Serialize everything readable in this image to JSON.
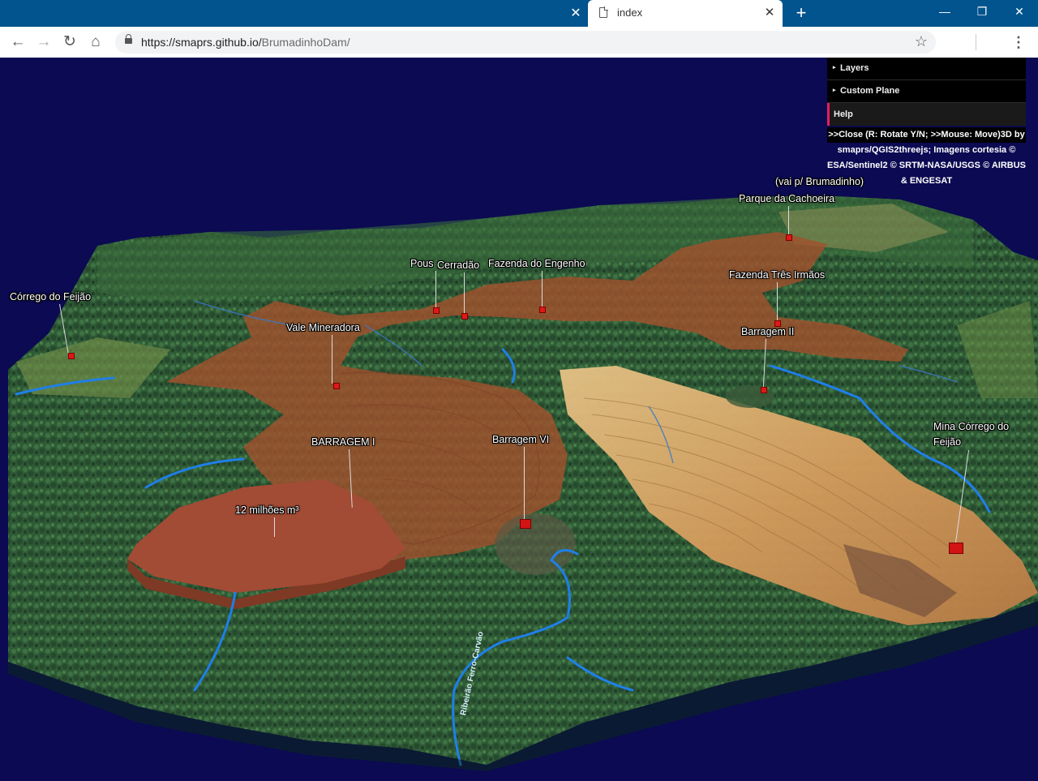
{
  "browser": {
    "tab_title": "index",
    "url_host": "https://smaprs.github.io/",
    "url_path": "BrumadinhoDam/"
  },
  "icons": [
    "back-arrow-icon",
    "forward-arrow-icon",
    "reload-icon",
    "home-icon",
    "lock-icon",
    "star-icon",
    "menu-dots-icon",
    "page-icon",
    "close-icon",
    "plus-icon"
  ],
  "glyphs": {
    "back": "←",
    "forward": "→",
    "reload": "↻",
    "home": "⌂",
    "star": "☆",
    "menu": "⋮",
    "close": "✕",
    "plus": "+",
    "minimize": "—",
    "maximize": "❐",
    "caret": "▸"
  },
  "gui": {
    "layers": "Layers",
    "custom_plane": "Custom Plane",
    "help": "Help",
    "info_line1": ">>Close (R: Rotate Y/N; >>Mouse: Move)3D by",
    "info_line2": "smaprs/QGIS2threejs; Imagens cortesia ©",
    "info_line3": "ESA/Sentinel2 © SRTM-NASA/USGS © AIRBUS",
    "info_line4": "& ENGESAT"
  },
  "labels": {
    "corrego": "Córrego do Feijão",
    "vale": "Vale Mineradora",
    "pousada": "Pous",
    "cerradao": "Cerradão",
    "fazenda_engenho": "Fazenda do Engenho",
    "vai_brumadinho": "(vai p/ Brumadinho)",
    "parque": "Parque da Cachoeira",
    "tres_irmaos": "Fazenda Três Irmãos",
    "barragem_ii": "Barragem II",
    "barragem_i": "BARRAGEM I",
    "volume": "12 milhões m³",
    "barragem_vi": "Barragem VI",
    "mina_1": "Mina Córrego do",
    "mina_2": "Feijão",
    "river": "Ribeirão Ferro-Carvão"
  },
  "colors": {
    "sky": "#0b0a52",
    "tab_bar": "#02548e",
    "gui_accent": "#e61d5f",
    "mud": "#a0522d",
    "tailings": "#a24b35",
    "marker": "#e01818",
    "river": "#1f7fe8"
  }
}
